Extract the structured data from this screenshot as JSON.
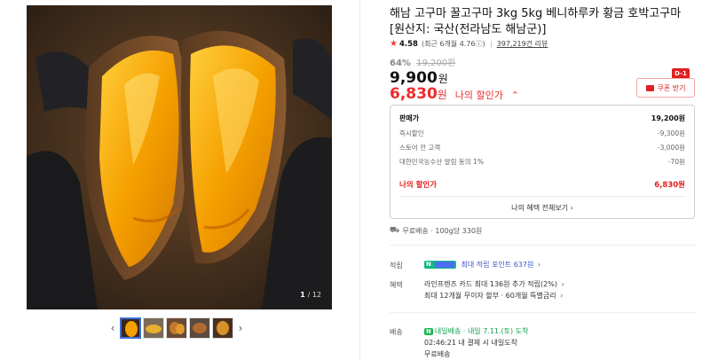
{
  "gallery": {
    "counter_current": "1",
    "counter_total": "/ 12",
    "prev_label": "‹",
    "next_label": "›"
  },
  "product": {
    "title": "해남 고구마 꿀고구마 3kg 5kg 베니하루카 황금 호박고구마 [원산지: 국산(전라남도 해남군)]",
    "rating_score": "4.58",
    "rating_recent": "(최근 6개월 4.76",
    "rating_info_icon": "ⓘ",
    "rating_recent_close": ")",
    "review_count": "397,219건 리뷰",
    "discount_rate": "64%",
    "original_price": "19,200원",
    "price": "9,900",
    "price_unit": "원",
    "my_price": "6,830",
    "my_price_unit": "원",
    "my_price_label": "나의 할인가",
    "my_price_toggle": "⌃"
  },
  "coupon": {
    "badge": "D-1",
    "label": "쿠폰 받기"
  },
  "breakdown": {
    "rows": [
      {
        "label": "판매가",
        "value": "19,200원"
      },
      {
        "label": "즉시할인",
        "value": "-9,300원"
      },
      {
        "label": "스토어 전 고객",
        "value": "-3,000원"
      },
      {
        "label": "대한민국농수산 알림 동의 1%",
        "value": "-70원"
      }
    ],
    "mine_label": "나의 할인가",
    "mine_value": "6,830원",
    "view_all": "나의 혜택 전체보기 ›"
  },
  "shipping_summary": {
    "icon": "⛟",
    "text": "무료배송 · 100g당 330원"
  },
  "points": {
    "label": "적립",
    "value": "최대 적립 포인트 637원",
    "chevron": "›"
  },
  "benefits": {
    "label": "혜택",
    "line1": "라인프렌즈 카드 최대 136원 추가 적립(2%)",
    "line2": "최대 12개월 무이자 할부 · 60개월 특별금리",
    "chevron": "›"
  },
  "delivery": {
    "label": "배송",
    "badge": "N",
    "service": "내일배송",
    "arrival": " · 내일 7.11.(토) 도착",
    "deadline": "02:46:21  내 결제 시 내일도착",
    "fee": "무료배송"
  },
  "colors": {
    "accent_red": "#e02020",
    "price_red": "#f02a2a",
    "naver_green": "#12b886",
    "border": "#cfcfcf"
  }
}
